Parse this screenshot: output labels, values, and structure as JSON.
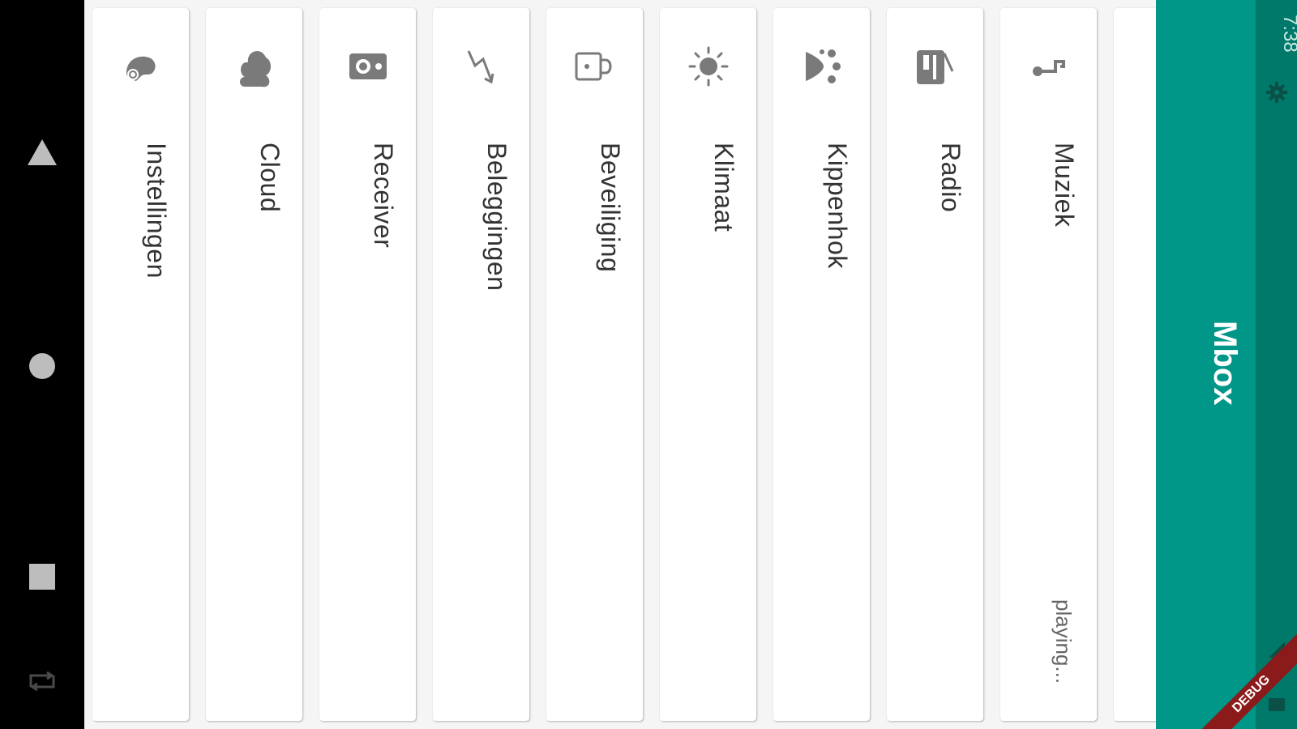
{
  "app": {
    "title": "Mbox"
  },
  "status_bar": {
    "time": "7:38",
    "icons": [
      "settings-icon",
      "signal-icon",
      "battery-icon"
    ]
  },
  "nav_bar": {
    "buttons": [
      "back-triangle-icon",
      "home-circle-icon",
      "recents-square-icon",
      "rotate-icon"
    ]
  },
  "tiles": [
    {
      "label": "Instellingen",
      "icon": "chameleon-icon",
      "subtitle": ""
    },
    {
      "label": "Cloud",
      "icon": "cloud-icon",
      "subtitle": ""
    },
    {
      "label": "Receiver",
      "icon": "speaker-icon",
      "subtitle": ""
    },
    {
      "label": "Beleggingen",
      "icon": "trending-icon",
      "subtitle": ""
    },
    {
      "label": "Beveiliging",
      "icon": "lock-icon",
      "subtitle": ""
    },
    {
      "label": "Klimaat",
      "icon": "sun-icon",
      "subtitle": ""
    },
    {
      "label": "Kippenhok",
      "icon": "paw-icon",
      "subtitle": ""
    },
    {
      "label": "Radio",
      "icon": "radio-icon",
      "subtitle": ""
    },
    {
      "label": "Muziek",
      "icon": "music-note-icon",
      "subtitle": "playing..."
    }
  ],
  "debug_banner": "DEBUG",
  "colors": {
    "app_bar": "#009688",
    "status_bar": "#00796b",
    "icon": "#7a7a7a",
    "nav_bar": "#000000"
  }
}
